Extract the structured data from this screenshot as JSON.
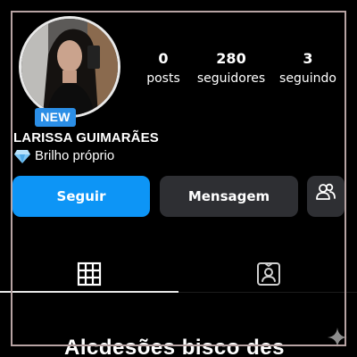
{
  "profile": {
    "name": "LARISSA GUIMARÃES",
    "bio": "Brilho próprio",
    "new_badge": "NEW"
  },
  "stats": {
    "posts": {
      "value": "0",
      "label": "posts"
    },
    "followers": {
      "value": "280",
      "label": "seguidores"
    },
    "following": {
      "value": "3",
      "label": "seguindo"
    }
  },
  "actions": {
    "follow_label": "Seguir",
    "message_label": "Mensagem",
    "suggest_icon": "add-person-icon"
  },
  "tabs": {
    "grid_icon": "grid-icon",
    "tagged_icon": "tagged-photos-icon",
    "active": "grid"
  },
  "bottom_text": "Alcdesões bisco des",
  "colors": {
    "background": "#000000",
    "follow_button": "#0d95f6",
    "secondary_button": "#2e2f33",
    "new_badge": "#2b8ee6",
    "frame": "#b7a3a3"
  }
}
